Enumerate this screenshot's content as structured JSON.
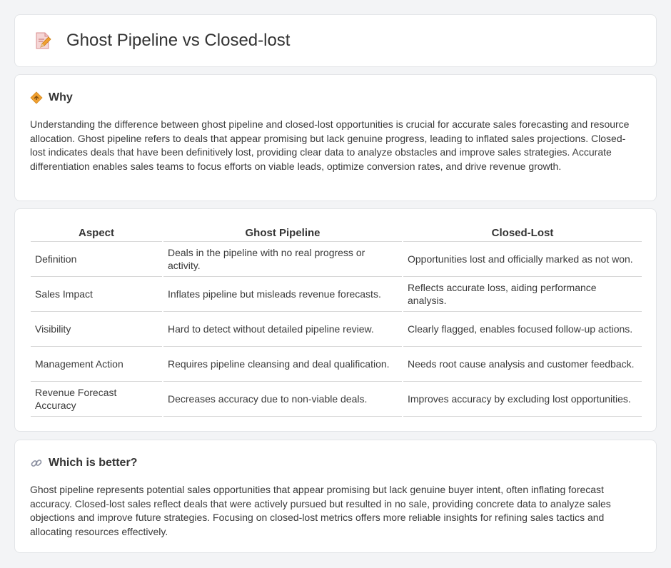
{
  "header": {
    "title": "Ghost Pipeline vs Closed-lost",
    "icon": "document-pencil-icon"
  },
  "why": {
    "icon": "diamond-signal-icon",
    "title": "Why",
    "body": "Understanding the difference between ghost pipeline and closed-lost opportunities is crucial for accurate sales forecasting and resource allocation. Ghost pipeline refers to deals that appear promising but lack genuine progress, leading to inflated sales projections. Closed-lost indicates deals that have been definitively lost, providing clear data to analyze obstacles and improve sales strategies. Accurate differentiation enables sales teams to focus efforts on viable leads, optimize conversion rates, and drive revenue growth."
  },
  "table": {
    "headers": [
      "Aspect",
      "Ghost Pipeline",
      "Closed-Lost"
    ],
    "rows": [
      [
        "Definition",
        "Deals in the pipeline with no real progress or activity.",
        "Opportunities lost and officially marked as not won."
      ],
      [
        "Sales Impact",
        "Inflates pipeline but misleads revenue forecasts.",
        "Reflects accurate loss, aiding performance analysis."
      ],
      [
        "Visibility",
        "Hard to detect without detailed pipeline review.",
        "Clearly flagged, enables focused follow-up actions."
      ],
      [
        "Management Action",
        "Requires pipeline cleansing and deal qualification.",
        "Needs root cause analysis and customer feedback."
      ],
      [
        "Revenue Forecast Accuracy",
        "Decreases accuracy due to non-viable deals.",
        "Improves accuracy by excluding lost opportunities."
      ]
    ]
  },
  "better": {
    "icon": "link-icon",
    "title": "Which is better?",
    "body": "Ghost pipeline represents potential sales opportunities that appear promising but lack genuine buyer intent, often inflating forecast accuracy. Closed-lost sales reflect deals that were actively pursued but resulted in no sale, providing concrete data to analyze sales objections and improve future strategies. Focusing on closed-lost metrics offers more reliable insights for refining sales tactics and allocating resources effectively."
  },
  "colors": {
    "background": "#f3f4f6",
    "card": "#ffffff",
    "text": "#333333",
    "accent_orange": "#f0a030",
    "icon_pink": "#e86a6a"
  }
}
